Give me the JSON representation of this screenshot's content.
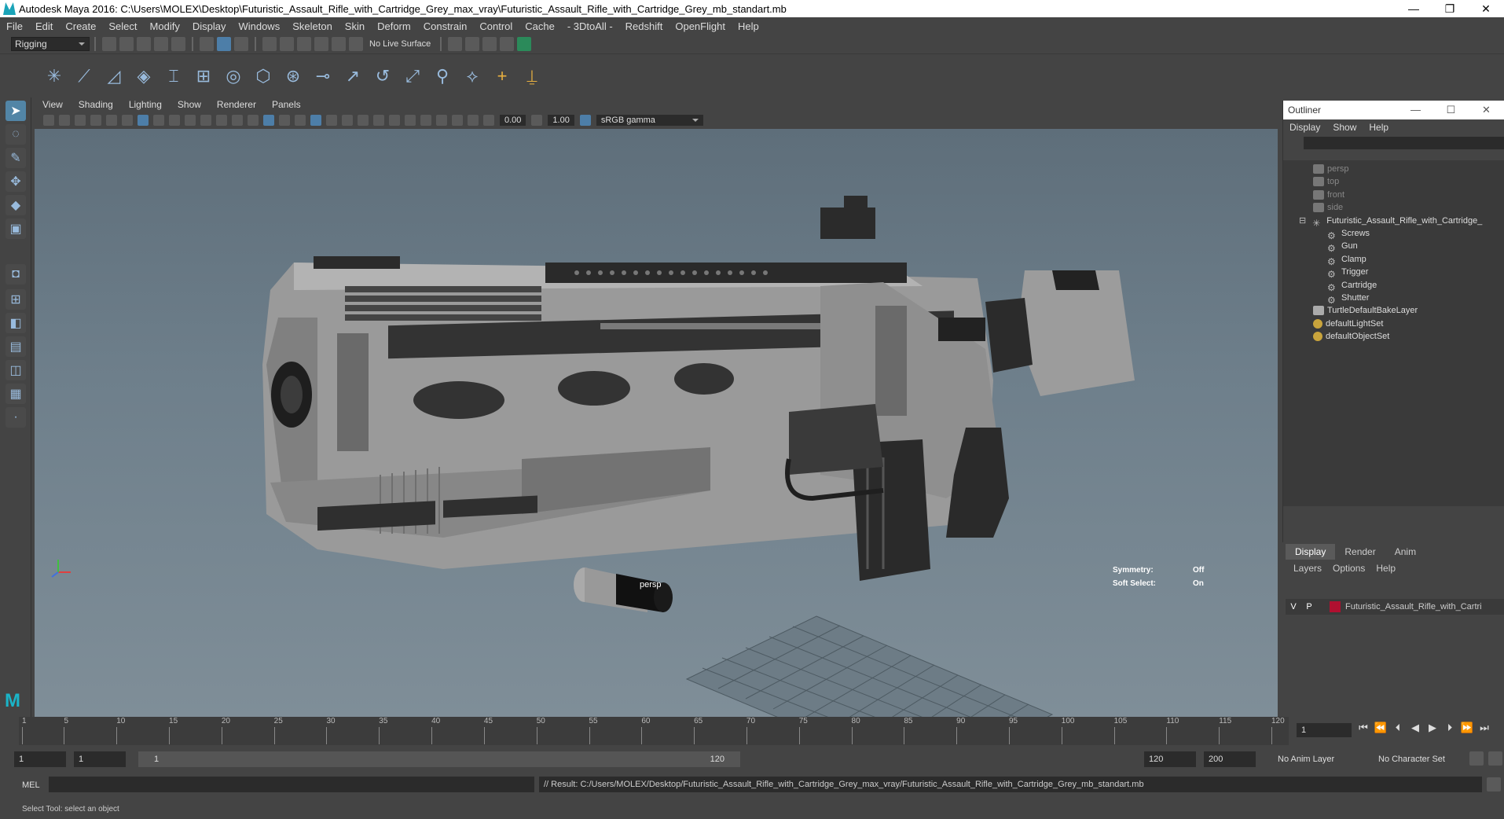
{
  "window": {
    "title": "Autodesk Maya 2016: C:\\Users\\MOLEX\\Desktop\\Futuristic_Assault_Rifle_with_Cartridge_Grey_max_vray\\Futuristic_Assault_Rifle_with_Cartridge_Grey_mb_standart.mb",
    "minimize": "—",
    "restore": "❐",
    "close": "✕"
  },
  "menubar": [
    "File",
    "Edit",
    "Create",
    "Select",
    "Modify",
    "Display",
    "Windows",
    "Skeleton",
    "Skin",
    "Deform",
    "Constrain",
    "Control",
    "Cache",
    "- 3DtoAll -",
    "Redshift",
    "OpenFlight",
    "Help"
  ],
  "toolbar": {
    "mode": "Rigging",
    "live_surface": "No Live Surface"
  },
  "viewport": {
    "menu": [
      "View",
      "Shading",
      "Lighting",
      "Show",
      "Renderer",
      "Panels"
    ],
    "exposure": "0.00",
    "gamma_value": "1.00",
    "color_space": "sRGB gamma",
    "camera_label": "persp",
    "hud": {
      "symmetry_label": "Symmetry:",
      "symmetry_value": "Off",
      "soft_select_label": "Soft Select:",
      "soft_select_value": "On"
    }
  },
  "outliner": {
    "title": "Outliner",
    "menu": [
      "Display",
      "Show",
      "Help"
    ],
    "items": [
      {
        "label": "persp",
        "type": "camera",
        "dim": true
      },
      {
        "label": "top",
        "type": "camera",
        "dim": true
      },
      {
        "label": "front",
        "type": "camera",
        "dim": true
      },
      {
        "label": "side",
        "type": "camera",
        "dim": true
      },
      {
        "label": "Futuristic_Assault_Rifle_with_Cartridge_",
        "type": "group",
        "expanded": true
      },
      {
        "label": "Screws",
        "type": "group",
        "child": true
      },
      {
        "label": "Gun",
        "type": "group",
        "child": true
      },
      {
        "label": "Clamp",
        "type": "group",
        "child": true
      },
      {
        "label": "Trigger",
        "type": "group",
        "child": true
      },
      {
        "label": "Cartridge",
        "type": "group",
        "child": true
      },
      {
        "label": "Shutter",
        "type": "group",
        "child": true
      },
      {
        "label": "TurtleDefaultBakeLayer",
        "type": "layer"
      },
      {
        "label": "defaultLightSet",
        "type": "set"
      },
      {
        "label": "defaultObjectSet",
        "type": "set"
      }
    ]
  },
  "layers": {
    "tabs": [
      "Display",
      "Render",
      "Anim"
    ],
    "active_tab": "Display",
    "menu": [
      "Layers",
      "Options",
      "Help"
    ],
    "row": {
      "v": "V",
      "p": "P",
      "name": "Futuristic_Assault_Rifle_with_Cartri",
      "color": "#b01030"
    }
  },
  "timeline": {
    "ticks": [
      "1",
      "5",
      "10",
      "15",
      "20",
      "25",
      "30",
      "35",
      "40",
      "45",
      "50",
      "55",
      "60",
      "65",
      "70",
      "75",
      "80",
      "85",
      "90",
      "95",
      "100",
      "105",
      "110",
      "115",
      "120"
    ],
    "current_frame": "1"
  },
  "range": {
    "start": "1",
    "playback_start": "1",
    "slider_start": "1",
    "slider_end": "120",
    "playback_end": "120",
    "end": "200",
    "anim_layer": "No Anim Layer",
    "character_set": "No Character Set"
  },
  "command": {
    "language": "MEL",
    "result": "// Result: C:/Users/MOLEX/Desktop/Futuristic_Assault_Rifle_with_Cartridge_Grey_max_vray/Futuristic_Assault_Rifle_with_Cartridge_Grey_mb_standart.mb"
  },
  "status": "Select Tool: select an object"
}
